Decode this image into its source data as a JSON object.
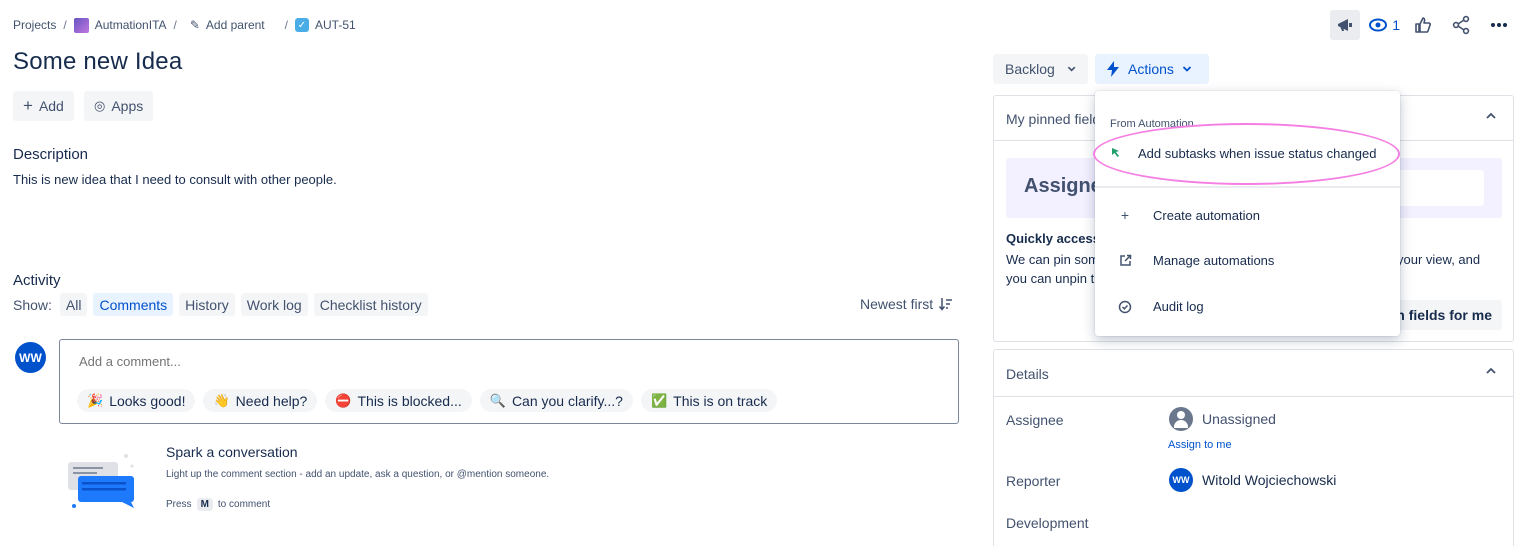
{
  "breadcrumb": {
    "projects": "Projects",
    "separator": "/",
    "project": "AutmationITA",
    "add_parent": "Add parent",
    "issue_key": "AUT-51"
  },
  "top_icons": {
    "feedback_icon": "megaphone-icon",
    "watch_icon": "eye-icon",
    "watch_count": "1",
    "like_icon": "thumbs-up-icon",
    "share_icon": "share-icon",
    "more_icon": "more-icon"
  },
  "issue": {
    "title": "Some new Idea",
    "add_label": "Add",
    "apps_label": "Apps",
    "description_heading": "Description",
    "description_text": "This is new idea that I need to consult with other people."
  },
  "activity": {
    "heading": "Activity",
    "show_label": "Show:",
    "filters": [
      "All",
      "Comments",
      "History",
      "Work log",
      "Checklist history"
    ],
    "selected_filter": "Comments",
    "sort_label": "Newest first",
    "avatar_initials": "WW",
    "comment_placeholder": "Add a comment...",
    "quick_replies": [
      {
        "emoji": "🎉",
        "label": "Looks good!"
      },
      {
        "emoji": "👋",
        "label": "Need help?"
      },
      {
        "emoji": "⛔",
        "label": "This is blocked..."
      },
      {
        "emoji": "🔍",
        "label": "Can you clarify...?"
      },
      {
        "emoji": "✅",
        "label": "This is on track"
      }
    ],
    "spark_title": "Spark a conversation",
    "spark_subtitle": "Light up the comment section - add an update, ask a question, or @mention someone.",
    "press_label": "Press",
    "press_key": "M",
    "press_suffix": "to comment"
  },
  "status": {
    "label": "Backlog",
    "actions_label": "Actions"
  },
  "pinned": {
    "header": "My pinned fields",
    "card_label": "Assignee",
    "quick_access": "Quickly access",
    "text_1a": "We can pin som",
    "text_1b": "your view, and",
    "text_2": "you can unpin t",
    "button": "in fields for me"
  },
  "details": {
    "header": "Details",
    "assignee_label": "Assignee",
    "assignee_value": "Unassigned",
    "assign_to_me": "Assign to me",
    "reporter_label": "Reporter",
    "reporter_initials": "WW",
    "reporter_name": "Witold Wojciechowski",
    "development_label": "Development"
  },
  "actions_menu": {
    "group_label": "From Automation",
    "automation_item": "Add subtasks when issue status changed",
    "items": [
      "Create automation",
      "Manage automations",
      "Audit log"
    ]
  },
  "colors": {
    "primary": "#0052cc",
    "highlight": "#f57ee3",
    "selected_bg": "#e9f2ff"
  }
}
